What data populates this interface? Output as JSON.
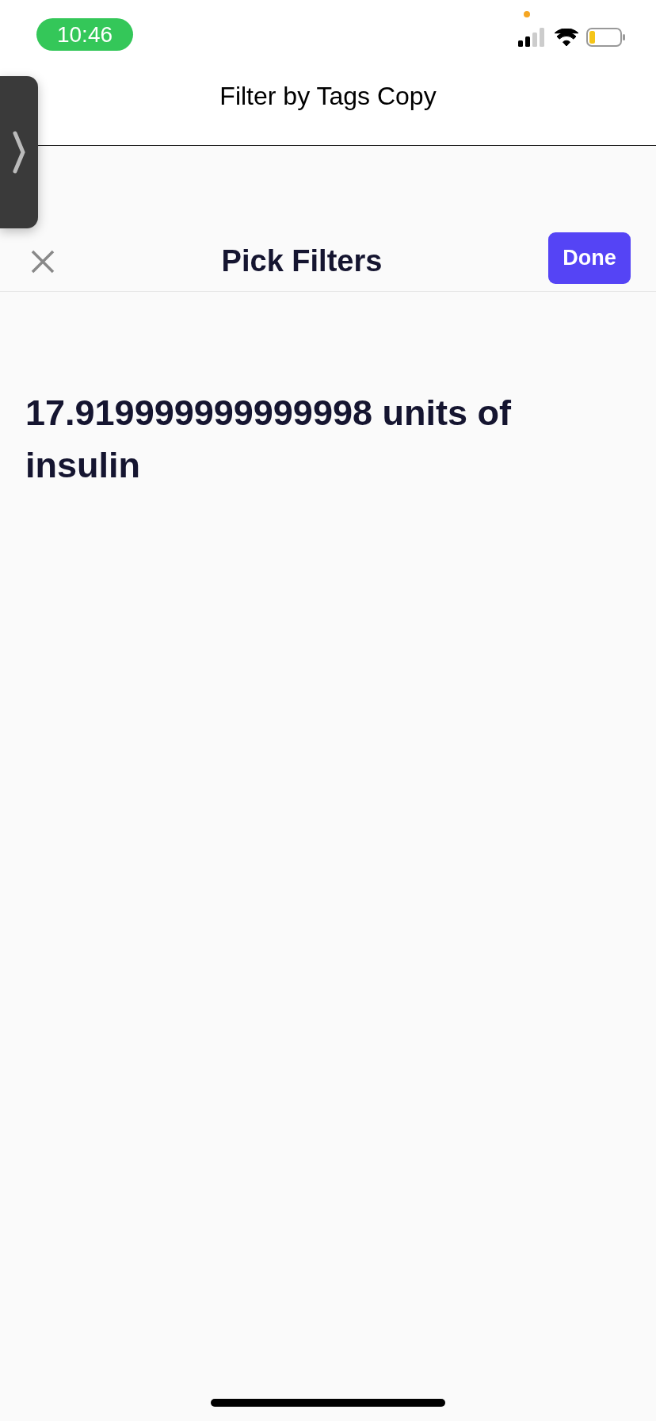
{
  "status_bar": {
    "time": "10:46"
  },
  "header": {
    "title": "Filter by Tags Copy"
  },
  "sheet": {
    "title": "Pick Filters",
    "done_button": "Done",
    "text": "17.919999999999998 units of insulin"
  }
}
